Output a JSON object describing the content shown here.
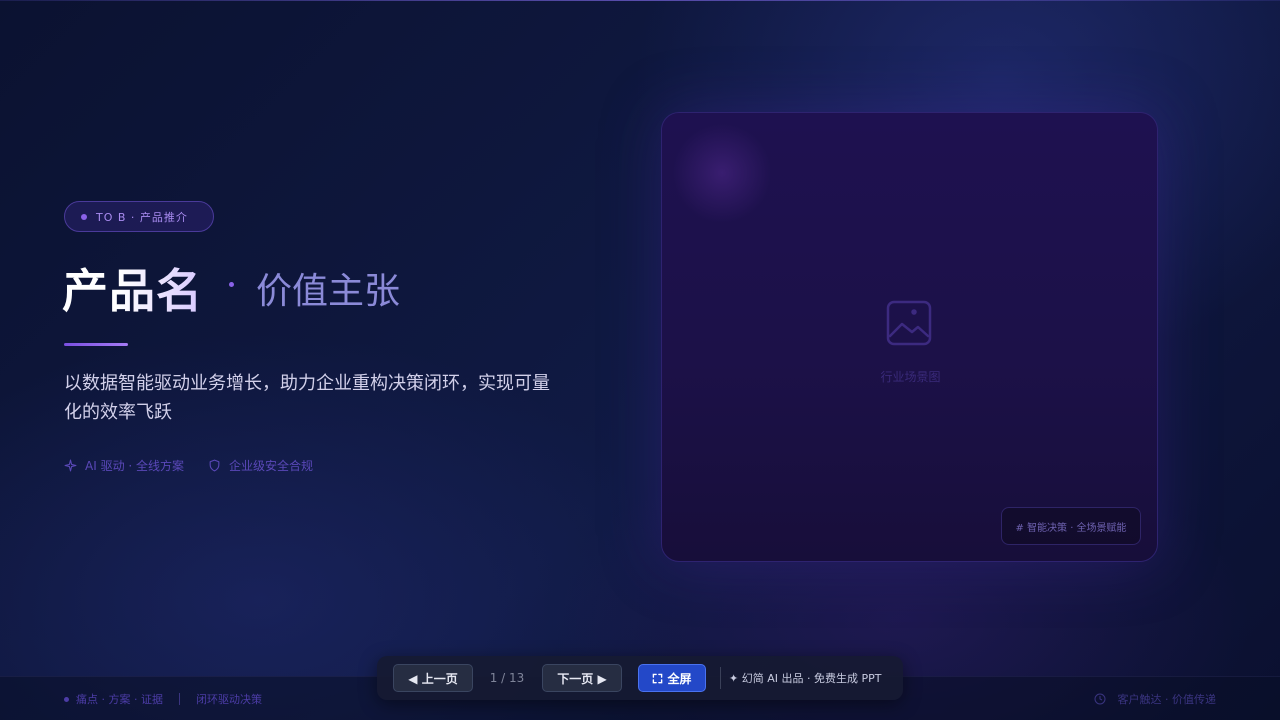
{
  "hero": {
    "tag": "TO B · 产品推介",
    "title": "产品名",
    "subtitle": "价值主张",
    "description": "以数据智能驱动业务增长，助力企业重构决策闭环，实现可量化的效率飞跃",
    "features": [
      {
        "icon": "sparkle-icon",
        "label": "AI 驱动 · 全线方案"
      },
      {
        "icon": "shield-icon",
        "label": "企业级安全合规"
      }
    ]
  },
  "card": {
    "image_caption": "行业场景图",
    "badge": "# 智能决策 · 全场景赋能"
  },
  "footer": {
    "left_primary": "痛点 · 方案 · 证据",
    "left_secondary": "闭环驱动决策",
    "right": "客户触达 · 价值传递"
  },
  "toolbar": {
    "prev_label": "◀ 上一页",
    "page_indicator": "1 / 13",
    "next_label": "下一页 ▶",
    "fullscreen_label": "全屏",
    "promo": "✦ 幻简 AI 出品 · 免费生成 PPT"
  },
  "colors": {
    "accent": "#8b62e8",
    "primary_button": "#2348c8",
    "background": "#0d1330"
  }
}
